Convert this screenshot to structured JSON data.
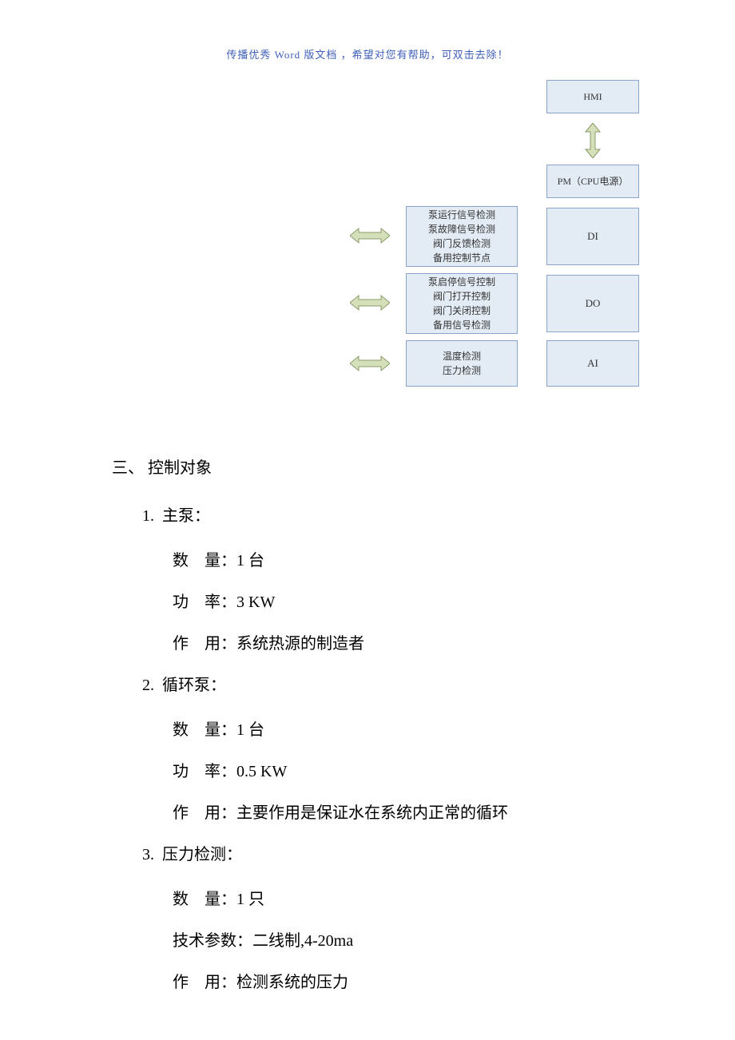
{
  "header": "传播优秀 Word 版文档 ，希望对您有帮助，可双击去除！",
  "diagram": {
    "hmi": "HMI",
    "pm": "PM（CPU电源）",
    "di": {
      "right": "DI",
      "left": [
        "泵运行信号检测",
        "泵故障信号检测",
        "阀门反馈检测",
        "备用控制节点"
      ]
    },
    "do": {
      "right": "DO",
      "left": [
        "泵启停信号控制",
        "阀门打开控制",
        "阀门关闭控制",
        "备用信号检测"
      ]
    },
    "ai": {
      "right": "AI",
      "left": [
        "温度检测",
        "压力检测"
      ]
    }
  },
  "sections": {
    "title": "三、 控制对象",
    "items": [
      {
        "num": "1.",
        "name": "主泵：",
        "details": [
          {
            "label": "数    量：",
            "value": "1 台"
          },
          {
            "label": "功    率：",
            "value": "3 KW"
          },
          {
            "label": "作    用：",
            "value": "系统热源的制造者"
          }
        ]
      },
      {
        "num": "2.",
        "name": "循环泵：",
        "details": [
          {
            "label": "数    量：",
            "value": "1 台"
          },
          {
            "label": "功    率：",
            "value": "0.5 KW"
          },
          {
            "label": "作    用：",
            "value": "主要作用是保证水在系统内正常的循环"
          }
        ]
      },
      {
        "num": "3.",
        "name": "压力检测：",
        "details": [
          {
            "label": "数    量：",
            "value": "1 只"
          },
          {
            "label": "技术参数：",
            "value": "二线制,4-20ma"
          },
          {
            "label": "作    用：",
            "value": "检测系统的压力"
          }
        ]
      }
    ]
  }
}
